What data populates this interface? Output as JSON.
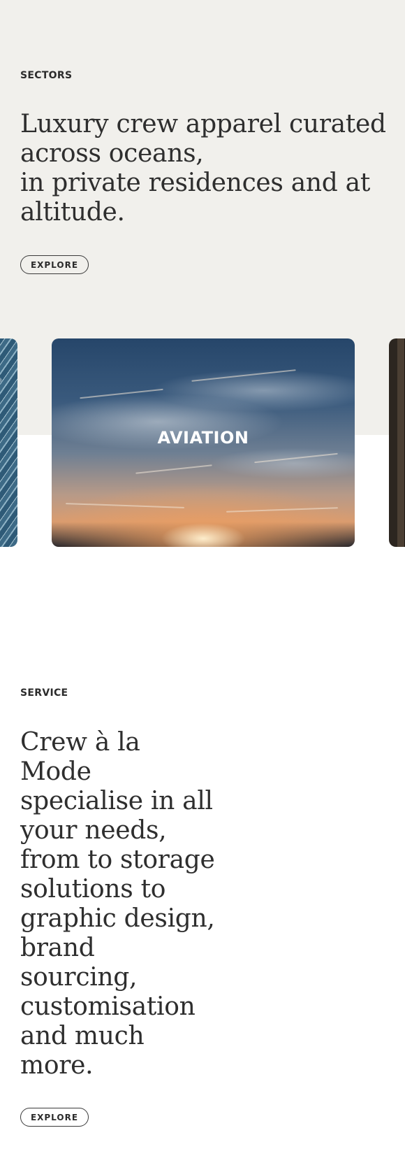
{
  "sectors": {
    "eyebrow": "SECTORS",
    "headline_lines": [
      "Luxury crew apparel curated",
      "across oceans,",
      "in private residences and at",
      "altitude."
    ],
    "explore_label": "EXPLORE"
  },
  "carousel": {
    "cards": [
      {
        "label": "",
        "theme": "ocean"
      },
      {
        "label": "AVIATION",
        "theme": "sunset-sky"
      },
      {
        "label": "",
        "theme": "residence"
      }
    ]
  },
  "service": {
    "eyebrow": "SERVICE",
    "headline_lines": [
      "Crew à la",
      "Mode",
      "specialise in all",
      "your needs,",
      "from to storage",
      "solutions to",
      "graphic design,",
      "brand",
      "sourcing,",
      "customisation",
      "and much",
      "more."
    ],
    "explore_label": "EXPLORE"
  },
  "colors": {
    "section_bg": "#f1f0ec",
    "page_bg": "#ffffff",
    "text": "#2e2e2e"
  }
}
